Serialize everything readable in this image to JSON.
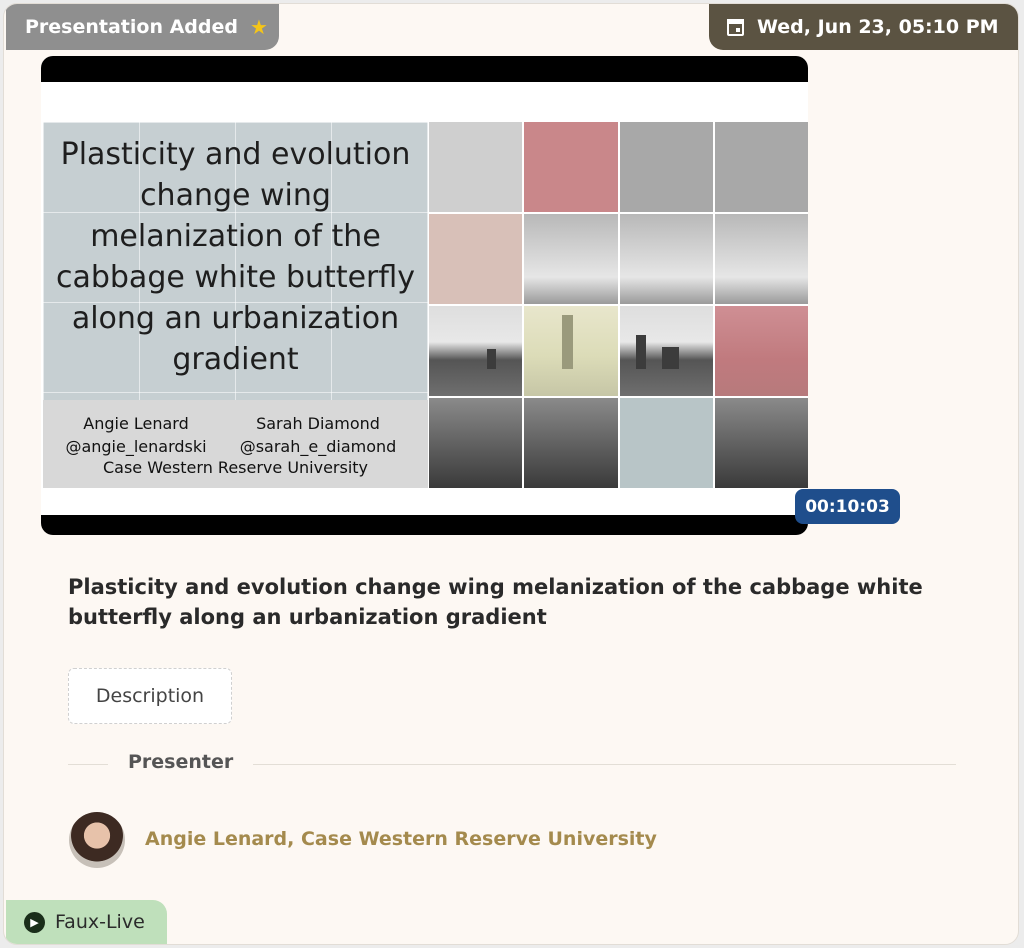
{
  "header": {
    "tag_label": "Presentation Added",
    "tag_icon": "star-icon",
    "date_text": "Wed, Jun 23, 05:10 PM",
    "date_icon": "calendar-icon"
  },
  "video": {
    "slide_title": "Plasticity and evolution change wing melanization of the cabbage white butterfly along an urbanization gradient",
    "author1_name": "Angie Lenard",
    "author1_handle": "@angie_lenardski",
    "author2_name": "Sarah Diamond",
    "author2_handle": "@sarah_e_diamond",
    "university": "Case Western Reserve University",
    "duration": "00:10:03"
  },
  "main": {
    "title": "Plasticity and evolution change wing melanization of the cabbage white butterfly along an urbanization gradient",
    "description_tab": "Description",
    "presenter_heading": "Presenter",
    "presenter_name": "Angie Lenard, Case Western Reserve University"
  },
  "footer": {
    "mode_label": "Faux-Live",
    "mode_icon": "play-circle-icon"
  },
  "colors": {
    "tag_added_bg": "#8f8f8f",
    "date_bg": "#5b5342",
    "timer_bg": "#1f4e8c",
    "presenter_name": "#a48a4d",
    "faux_live_bg": "#bfe0bb"
  }
}
